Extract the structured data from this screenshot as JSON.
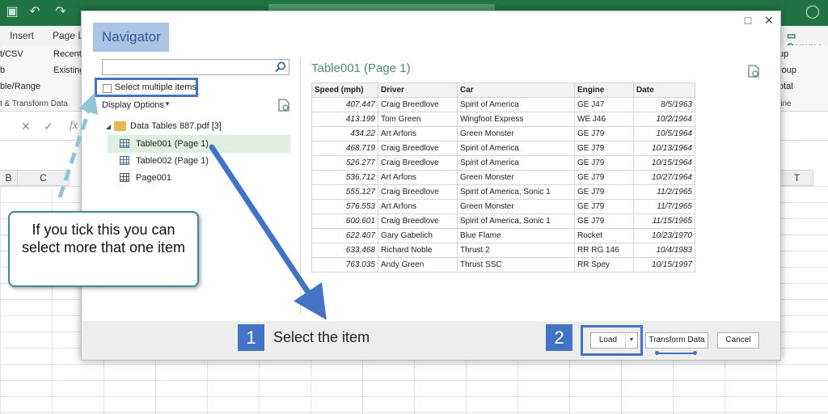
{
  "excel": {
    "ribbon_tabs": [
      "Insert",
      "Page L"
    ],
    "comments_label": "Comme",
    "ribbon_items": [
      "t/CSV",
      "Recent",
      "b",
      "Existing",
      "ble/Range",
      "t & Transform Data",
      "up",
      "roup",
      "otal",
      "line"
    ],
    "formula_icons": [
      "close-icon",
      "check-icon",
      "fx-icon"
    ],
    "fx_label": "fx",
    "columns": [
      "B",
      "C",
      "T"
    ]
  },
  "navigator": {
    "title": "Navigator",
    "search": {
      "placeholder": "",
      "value": ""
    },
    "select_multiple_label": "Select multiple items",
    "display_options_label": "Display Options",
    "tree": {
      "root_label": "Data Tables 887.pdf [3]",
      "items": [
        {
          "label": "Table001 (Page 1)",
          "icon": "table-icon",
          "selected": true
        },
        {
          "label": "Table002 (Page 1)",
          "icon": "table-icon",
          "selected": false
        },
        {
          "label": "Page001",
          "icon": "page-icon",
          "selected": false
        }
      ]
    },
    "preview_title": "Table001 (Page 1)",
    "table": {
      "headers": [
        "Speed (mph)",
        "Driver",
        "Car",
        "Engine",
        "Date"
      ],
      "rows": [
        [
          "407.447",
          "Craig Breedlove",
          "Spirit of America",
          "GE J47",
          "8/5/1963"
        ],
        [
          "413.199",
          "Tom Green",
          "Wingfoot Express",
          "WE J46",
          "10/2/1964"
        ],
        [
          "434.22",
          "Art Arfons",
          "Green Monster",
          "GE J79",
          "10/5/1964"
        ],
        [
          "468.719",
          "Craig Breedlove",
          "Spirit of America",
          "GE J79",
          "10/13/1964"
        ],
        [
          "526.277",
          "Craig Breedlove",
          "Spirit of America",
          "GE J79",
          "10/15/1964"
        ],
        [
          "536.712",
          "Art Arfons",
          "Green Monster",
          "GE J79",
          "10/27/1964"
        ],
        [
          "555.127",
          "Craig Breedlove",
          "Spirit of America, Sonic 1",
          "GE J79",
          "11/2/1965"
        ],
        [
          "576.553",
          "Art Arfons",
          "Green Monster",
          "GE J79",
          "11/7/1965"
        ],
        [
          "600.601",
          "Craig Breedlove",
          "Spirit of America, Sonic 1",
          "GE J79",
          "11/15/1965"
        ],
        [
          "622.407",
          "Gary Gabelich",
          "Blue Flame",
          "Rocket",
          "10/23/1970"
        ],
        [
          "633.468",
          "Richard Noble",
          "Thrust 2",
          "RR RG 146",
          "10/4/1983"
        ],
        [
          "763.035",
          "Andy Green",
          "Thrust SSC",
          "RR Spey",
          "10/15/1997"
        ]
      ]
    },
    "buttons": {
      "load": "Load",
      "transform": "Transform Data",
      "cancel": "Cancel"
    }
  },
  "annotations": {
    "callout_text": "If you tick this you can select more that one item",
    "step1_number": "1",
    "step1_text": "Select the item",
    "step2_number": "2"
  },
  "colors": {
    "excel_green": "#217346",
    "accent_blue": "#4472c4",
    "selected_row": "#ddf0df",
    "callout_border": "#3f8a8a",
    "title_green": "#4f8f6a"
  }
}
